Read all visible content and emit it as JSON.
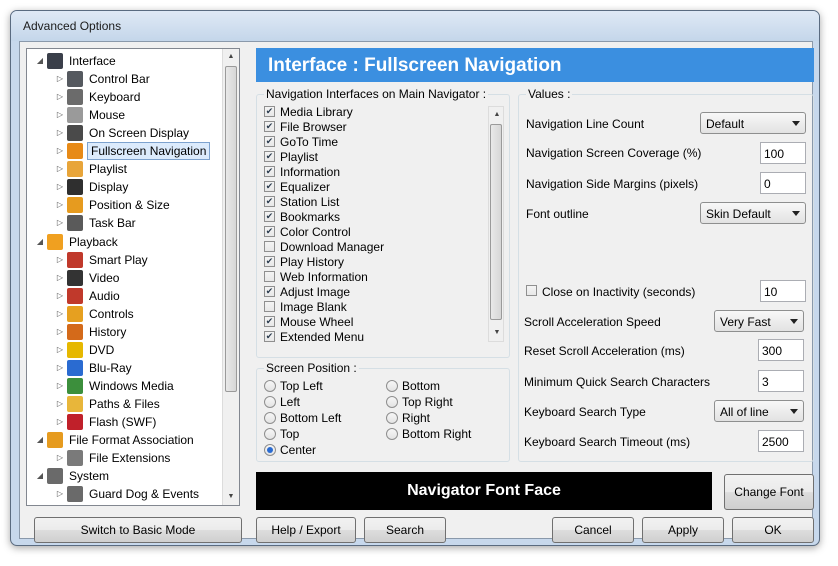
{
  "window": {
    "title": "Advanced Options"
  },
  "tree": {
    "items": [
      {
        "label": "Interface",
        "icon": "monitor-icon",
        "color": "#3a3f4a",
        "level": 0,
        "expanded": true
      },
      {
        "label": "Control Bar",
        "icon": "control-bar-icon",
        "color": "#55595f",
        "level": 1
      },
      {
        "label": "Keyboard",
        "icon": "keyboard-icon",
        "color": "#6b6b6b",
        "level": 1
      },
      {
        "label": "Mouse",
        "icon": "mouse-icon",
        "color": "#9a9a9a",
        "level": 1
      },
      {
        "label": "On Screen Display",
        "icon": "osd-icon",
        "color": "#4a4a4a",
        "level": 1
      },
      {
        "label": "Fullscreen Navigation",
        "icon": "fullscreen-icon",
        "color": "#e78a17",
        "level": 1,
        "selected": true
      },
      {
        "label": "Playlist",
        "icon": "playlist-icon",
        "color": "#e8a53a",
        "level": 1
      },
      {
        "label": "Display",
        "icon": "display-icon",
        "color": "#2f2f2f",
        "level": 1
      },
      {
        "label": "Position & Size",
        "icon": "position-icon",
        "color": "#e69b1f",
        "level": 1
      },
      {
        "label": "Task Bar",
        "icon": "taskbar-icon",
        "color": "#5a5a5a",
        "level": 1
      },
      {
        "label": "Playback",
        "icon": "playback-icon",
        "color": "#f0a020",
        "level": 0,
        "expanded": true
      },
      {
        "label": "Smart Play",
        "icon": "smart-play-icon",
        "color": "#c0392b",
        "level": 1
      },
      {
        "label": "Video",
        "icon": "video-icon",
        "color": "#333333",
        "level": 1
      },
      {
        "label": "Audio",
        "icon": "audio-icon",
        "color": "#c0392b",
        "level": 1
      },
      {
        "label": "Controls",
        "icon": "controls-icon",
        "color": "#e6a020",
        "level": 1
      },
      {
        "label": "History",
        "icon": "history-icon",
        "color": "#d46a1a",
        "level": 1
      },
      {
        "label": "DVD",
        "icon": "dvd-icon",
        "color": "#e6b800",
        "level": 1
      },
      {
        "label": "Blu-Ray",
        "icon": "bluray-icon",
        "color": "#2a6bd1",
        "level": 1
      },
      {
        "label": "Windows Media",
        "icon": "windows-media-icon",
        "color": "#3c8f3c",
        "level": 1
      },
      {
        "label": "Paths & Files",
        "icon": "folder-icon",
        "color": "#e8b63a",
        "level": 1
      },
      {
        "label": "Flash (SWF)",
        "icon": "flash-icon",
        "color": "#c0202a",
        "level": 1
      },
      {
        "label": "File Format Association",
        "icon": "file-format-icon",
        "color": "#e69b1f",
        "level": 0,
        "expanded": true
      },
      {
        "label": "File Extensions",
        "icon": "file-extensions-icon",
        "color": "#7a7a7a",
        "level": 1
      },
      {
        "label": "System",
        "icon": "system-icon",
        "color": "#6a6a6a",
        "level": 0,
        "expanded": true
      },
      {
        "label": "Guard Dog & Events",
        "icon": "guard-dog-icon",
        "color": "#6a6a6a",
        "level": 1
      }
    ]
  },
  "header": {
    "title": "Interface : Fullscreen Navigation"
  },
  "navigators": {
    "title": "Navigation Interfaces on Main Navigator :",
    "items": [
      {
        "label": "Media Library",
        "checked": true
      },
      {
        "label": "File Browser",
        "checked": true
      },
      {
        "label": "GoTo Time",
        "checked": true
      },
      {
        "label": "Playlist",
        "checked": true
      },
      {
        "label": "Information",
        "checked": true
      },
      {
        "label": "Equalizer",
        "checked": true
      },
      {
        "label": "Station List",
        "checked": true
      },
      {
        "label": "Bookmarks",
        "checked": true
      },
      {
        "label": "Color Control",
        "checked": true
      },
      {
        "label": "Download Manager",
        "checked": false
      },
      {
        "label": "Play History",
        "checked": true
      },
      {
        "label": "Web Information",
        "checked": false
      },
      {
        "label": "Adjust Image",
        "checked": true
      },
      {
        "label": "Image Blank",
        "checked": false
      },
      {
        "label": "Mouse Wheel",
        "checked": true
      },
      {
        "label": "Extended Menu",
        "checked": true
      }
    ]
  },
  "screen_position": {
    "title": "Screen Position :",
    "options": [
      {
        "label": "Top Left",
        "selected": false
      },
      {
        "label": "Left",
        "selected": false
      },
      {
        "label": "Bottom Left",
        "selected": false
      },
      {
        "label": "Top",
        "selected": false
      },
      {
        "label": "Center",
        "selected": true
      },
      {
        "label": "Bottom",
        "selected": false
      },
      {
        "label": "Top Right",
        "selected": false
      },
      {
        "label": "Right",
        "selected": false
      },
      {
        "label": "Bottom Right",
        "selected": false
      }
    ]
  },
  "values": {
    "title": "Values :",
    "nav_line_count": {
      "label": "Navigation Line Count",
      "value": "Default"
    },
    "coverage": {
      "label": "Navigation Screen Coverage (%)",
      "value": "100"
    },
    "side_margins": {
      "label": "Navigation Side Margins (pixels)",
      "value": "0"
    },
    "font_outline": {
      "label": "Font outline",
      "value": "Skin Default"
    },
    "close_inactivity": {
      "label": "Close on Inactivity (seconds)",
      "checked": false,
      "value": "10"
    },
    "scroll_speed": {
      "label": "Scroll Acceleration Speed",
      "value": "Very Fast"
    },
    "reset_scroll": {
      "label": "Reset Scroll Acceleration (ms)",
      "value": "300"
    },
    "min_search_chars": {
      "label": "Minimum Quick Search Characters",
      "value": "3"
    },
    "search_type": {
      "label": "Keyboard Search Type",
      "value": "All of line"
    },
    "search_timeout": {
      "label": "Keyboard Search Timeout (ms)",
      "value": "2500"
    }
  },
  "font": {
    "preview": "Navigator Font Face",
    "change_label": "Change Font"
  },
  "buttons": {
    "basic_mode": "Switch to Basic Mode",
    "help_export": "Help / Export",
    "search": "Search",
    "cancel": "Cancel",
    "apply": "Apply",
    "ok": "OK"
  },
  "colors": {
    "header_bg": "#3b8fe0",
    "selection_bg": "#dcebfc",
    "font_preview_bg": "#000000"
  }
}
